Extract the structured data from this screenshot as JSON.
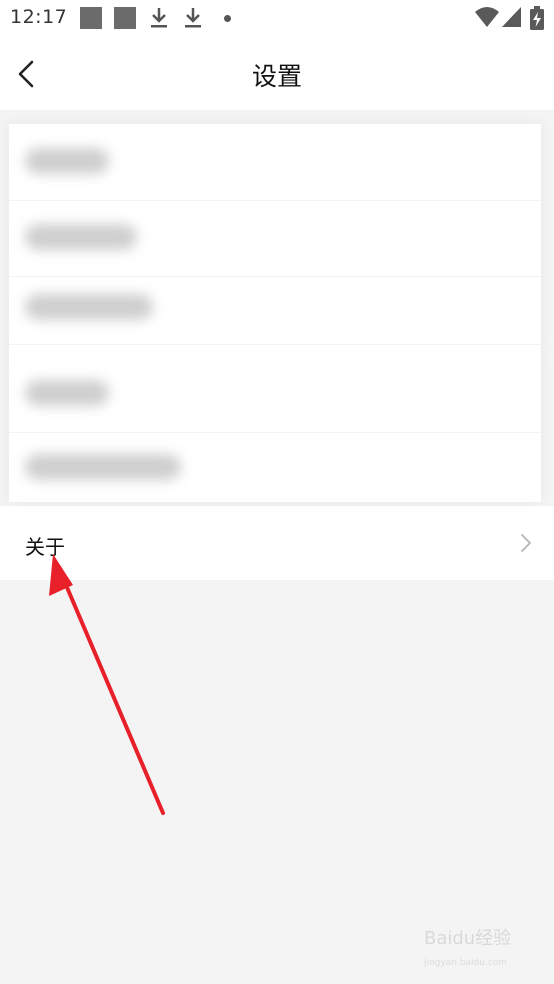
{
  "status_bar": {
    "time": "12:17"
  },
  "nav": {
    "title": "设置"
  },
  "settings": {
    "about_label": "关于"
  },
  "watermark": {
    "brand": "Baidu经验",
    "url": "jingyan.baidu.com"
  },
  "colors": {
    "annotation_arrow": "#e8202a",
    "page_background": "#f4f4f4"
  }
}
